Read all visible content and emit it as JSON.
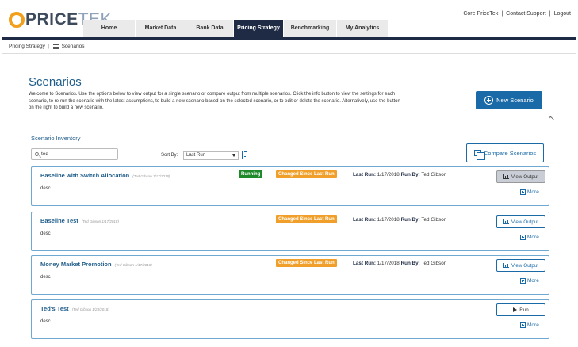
{
  "logo": {
    "part1": "PRICE",
    "part2": "TEK"
  },
  "nav": {
    "tabs": [
      {
        "label": "Home",
        "active": false
      },
      {
        "label": "Market Data",
        "active": false
      },
      {
        "label": "Bank Data",
        "active": false
      },
      {
        "label": "Pricing Strategy",
        "active": true
      },
      {
        "label": "Benchmarking",
        "active": false
      },
      {
        "label": "My Analytics",
        "active": false
      }
    ]
  },
  "util_links": [
    "Core PriceTek",
    "Contact Support",
    "Logout"
  ],
  "breadcrumb": {
    "parent": "Pricing Strategy",
    "current": "Scenarios"
  },
  "page": {
    "title": "Scenarios",
    "intro": "Welcome to Scenarios. Use the options below to view output for a single scenario or compare output from multiple scenarios. Click the info button to view the settings for each scenario, to re-run the scenario with the latest assumptions, to build a new scenario based on the selected scenario, or to edit or delete the scenario. Alternatively, use the button on the right to build a new scenario.",
    "new_button": "New Scenario",
    "inventory_title": "Scenario Inventory",
    "search_value": "ted",
    "sort_label": "Sort By:",
    "sort_value": "Last Run",
    "compare_button": "Compare Scenarios"
  },
  "cards": [
    {
      "name": "Baseline with Switch Allocation",
      "meta": "(Ted Gibson 1/17/2018)",
      "desc": "desc",
      "running": "Running",
      "changed": "Changed Since Last Run",
      "last_run_label": "Last Run:",
      "last_run": "1/17/2018",
      "run_by_label": "Run By:",
      "run_by": "Ted Gibson",
      "action": "View Output",
      "more": "More"
    },
    {
      "name": "Baseline Test",
      "meta": "(Ted Gibson 1/17/2018)",
      "desc": "desc",
      "changed": "Changed Since Last Run",
      "last_run_label": "Last Run:",
      "last_run": "1/17/2018",
      "run_by_label": "Run By:",
      "run_by": "Ted Gibson",
      "action": "View Output",
      "more": "More"
    },
    {
      "name": "Money Market Promotion",
      "meta": "(Ted Gibson 1/17/2018)",
      "desc": "desc",
      "changed": "Changed Since Last Run",
      "last_run_label": "Last Run:",
      "last_run": "1/17/2018",
      "run_by_label": "Run By:",
      "run_by": "Ted Gibson",
      "action": "View Output",
      "more": "More"
    },
    {
      "name": "Ted's Test",
      "meta": "(Ted Gibson 1/23/2018)",
      "desc": "desc",
      "action": "Run",
      "more": "More"
    }
  ],
  "colors": {
    "accent": "#1a6aa8",
    "nav_dark": "#1f2a44",
    "running": "#1f8a2a",
    "changed": "#f0a02a"
  }
}
